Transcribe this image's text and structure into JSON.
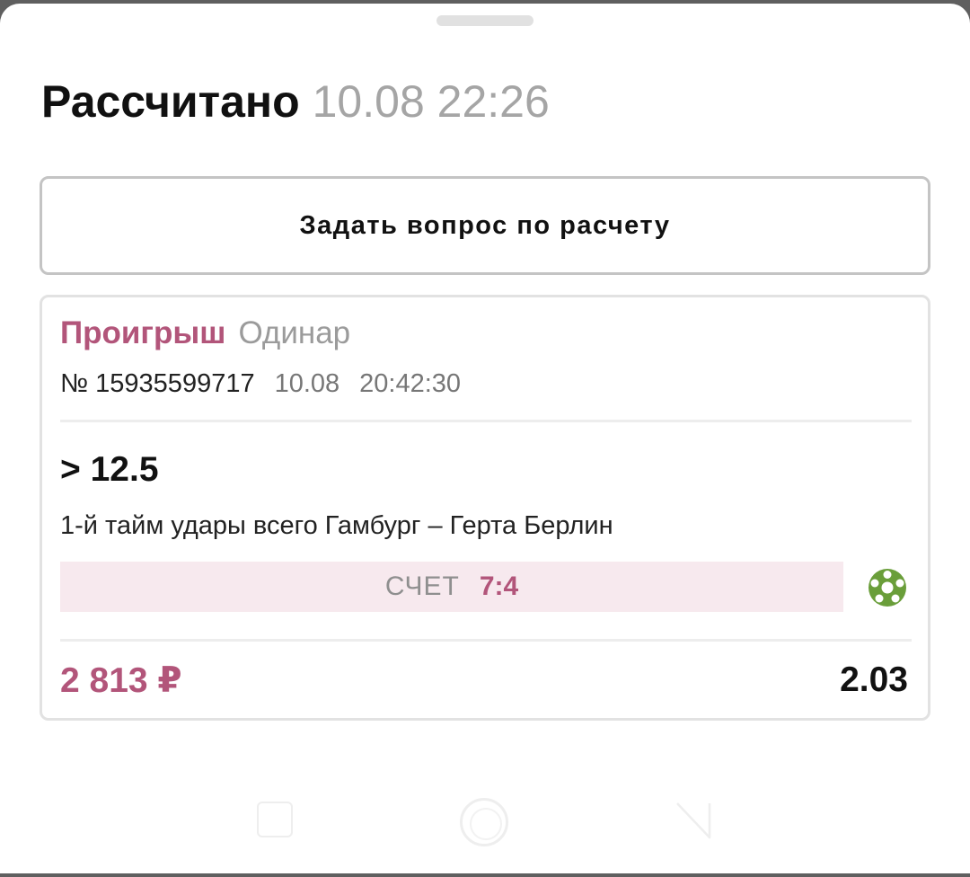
{
  "header": {
    "title": "Рассчитано",
    "time": "10.08 22:26"
  },
  "actions": {
    "ask_label": "Задать вопрос по расчету"
  },
  "bet": {
    "result": "Проигрыш",
    "type": "Одинар",
    "number": "№ 15935599717",
    "date": "10.08",
    "time": "20:42:30",
    "outcome": "> 12.5",
    "event": "1-й тайм удары всего Гамбург – Герта Берлин",
    "score_label": "СЧЕТ",
    "score_value": "7:4",
    "stake": "2 813 ₽",
    "odds": "2.03",
    "sport_icon": "soccer-ball-icon"
  },
  "colors": {
    "accent": "#b2557a",
    "score_bg": "#f7e9ee",
    "sport_icon": "#6a9e3a",
    "muted": "#9b9b9b"
  },
  "navbar": {
    "icons": [
      "recent-apps-icon",
      "home-icon",
      "back-icon"
    ]
  }
}
